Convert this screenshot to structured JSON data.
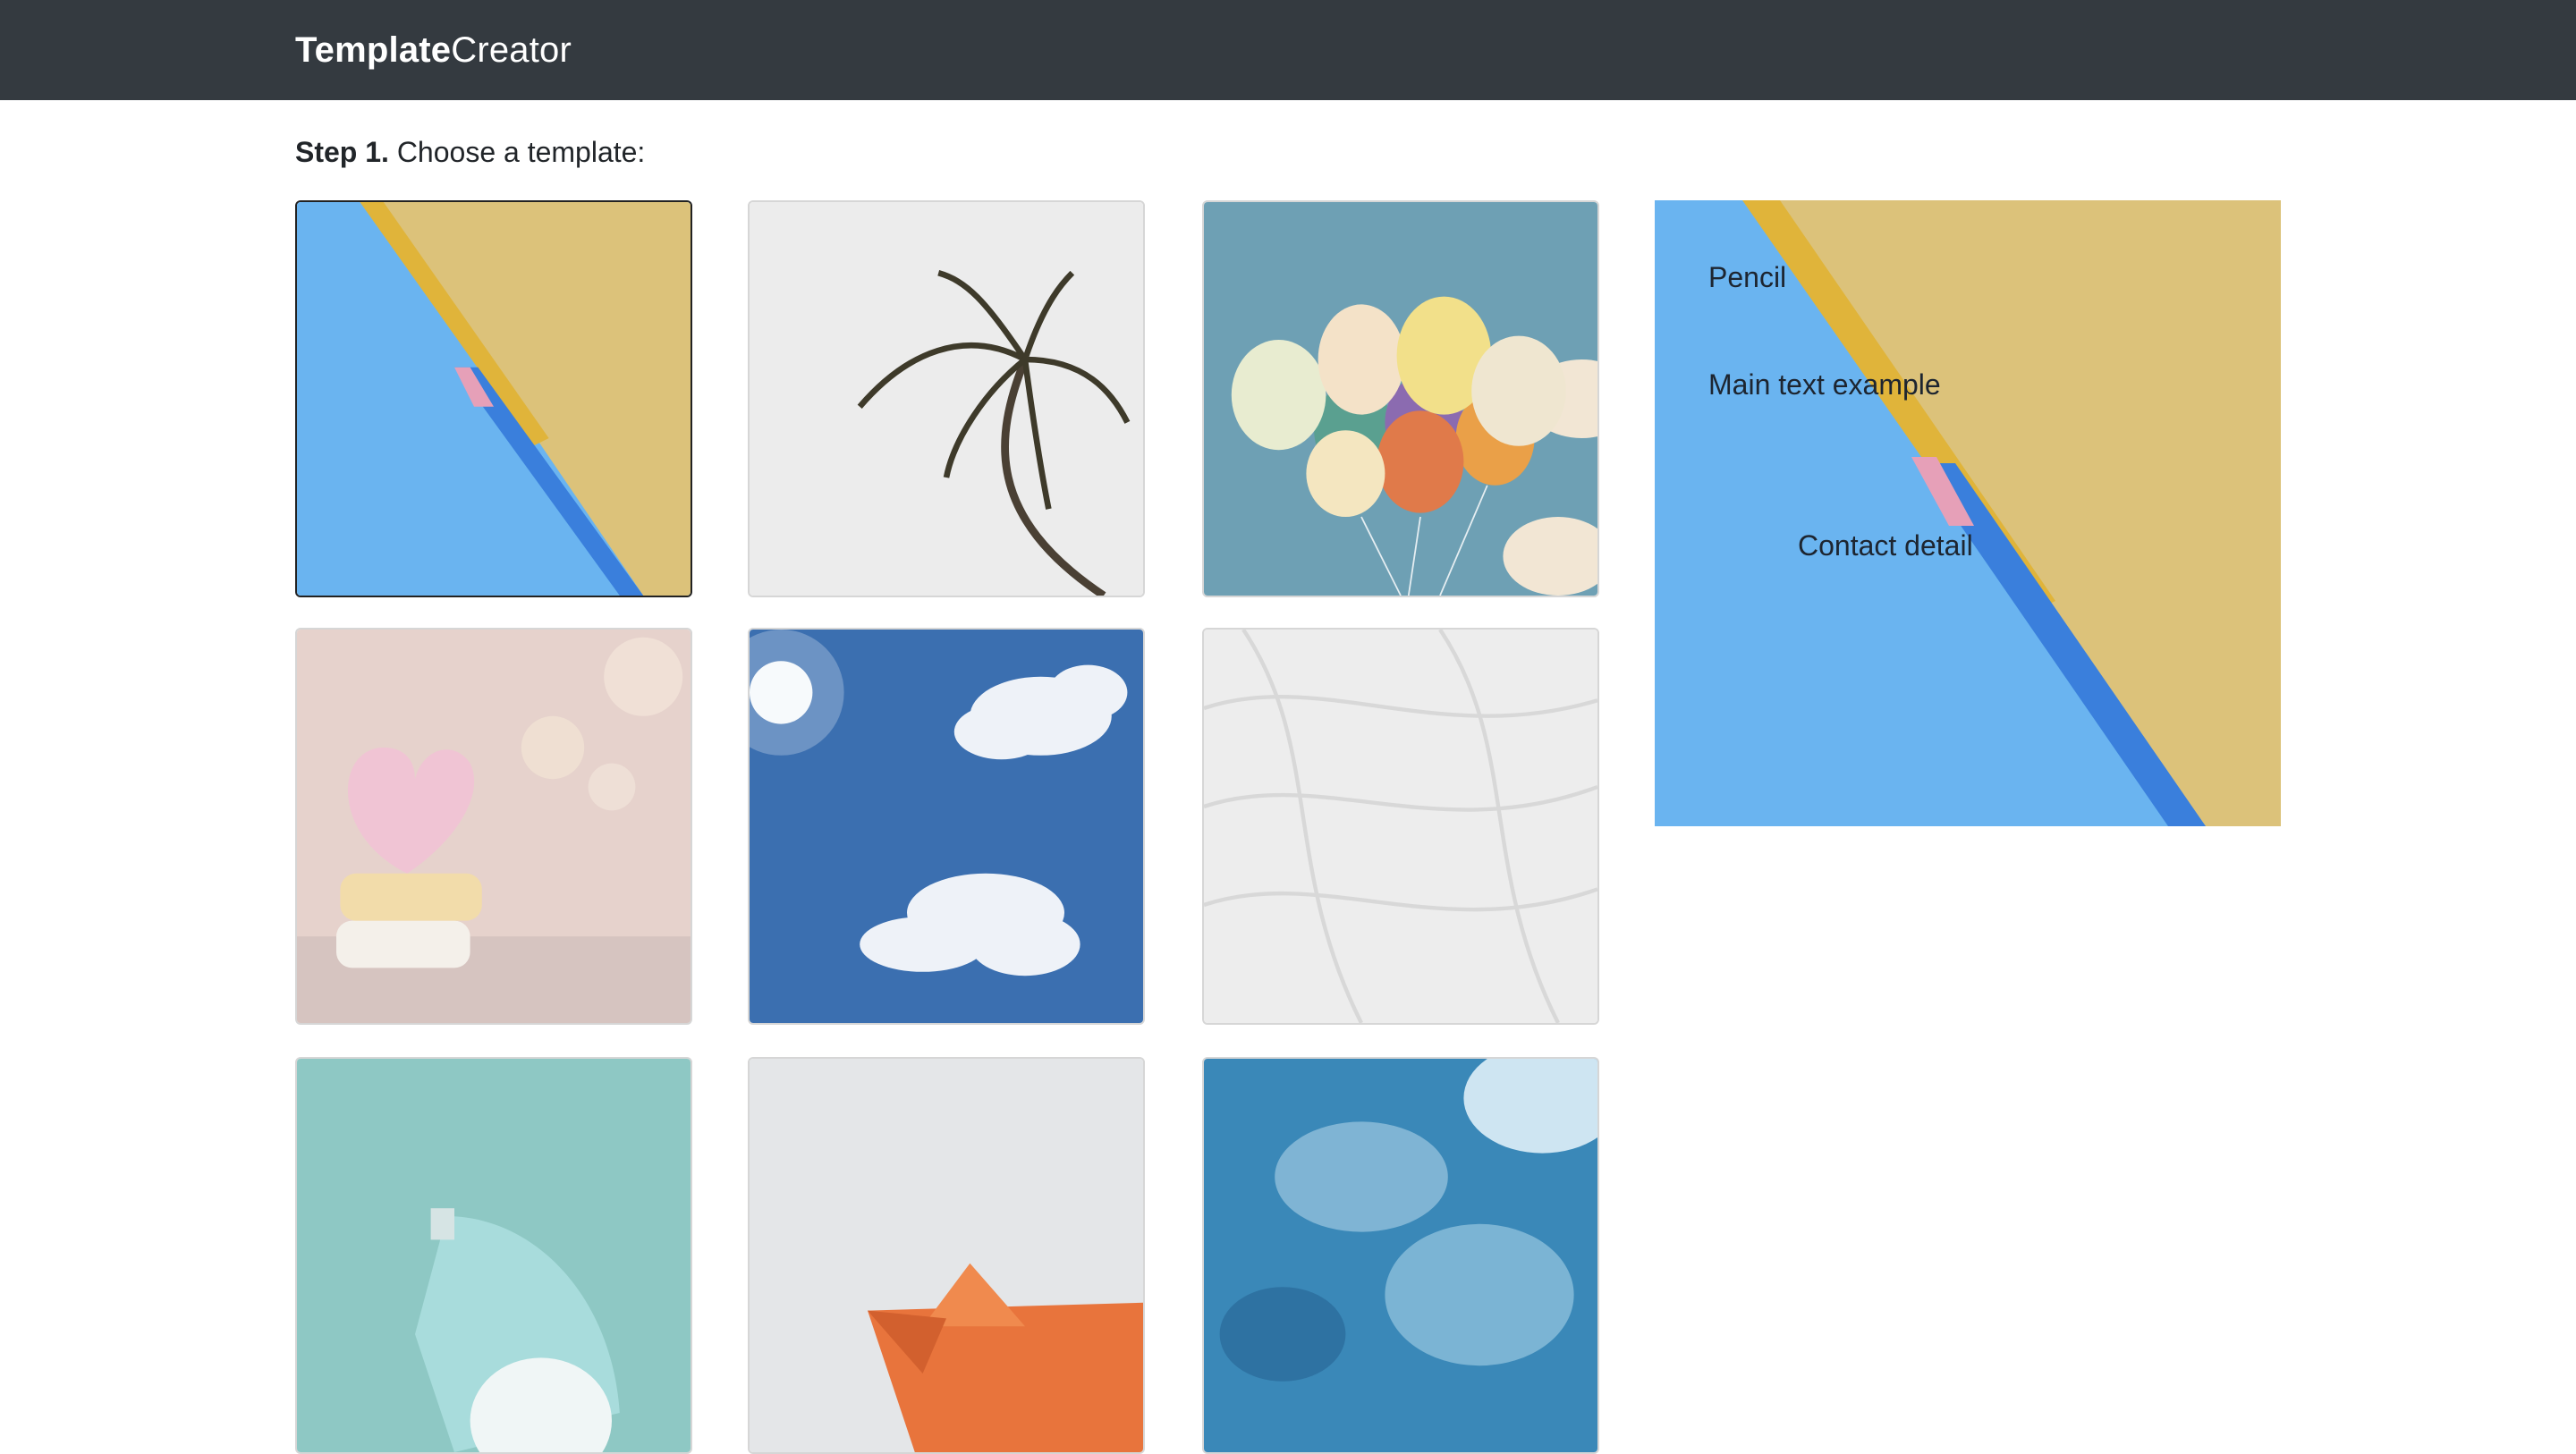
{
  "header": {
    "brand_bold": "Template",
    "brand_light": "Creator"
  },
  "step": {
    "label": "Step 1.",
    "text": "Choose a template:"
  },
  "templates": [
    {
      "icon": "pencil-image",
      "selected": true
    },
    {
      "icon": "palm-tree-image",
      "selected": false
    },
    {
      "icon": "balloons-image",
      "selected": false
    },
    {
      "icon": "candy-heart-image",
      "selected": false
    },
    {
      "icon": "sky-clouds-image",
      "selected": false
    },
    {
      "icon": "white-texture-image",
      "selected": false
    },
    {
      "icon": "desk-lamp-image",
      "selected": false
    },
    {
      "icon": "paper-boat-image",
      "selected": false
    },
    {
      "icon": "underwater-image",
      "selected": false
    }
  ],
  "preview": {
    "title": "Pencil",
    "main_text": "Main text example",
    "contact": "Contact detail"
  },
  "colors": {
    "navbar": "#343a40",
    "pencil_blue": "#6ab4f0",
    "pencil_yellow": "#dcc27a"
  }
}
